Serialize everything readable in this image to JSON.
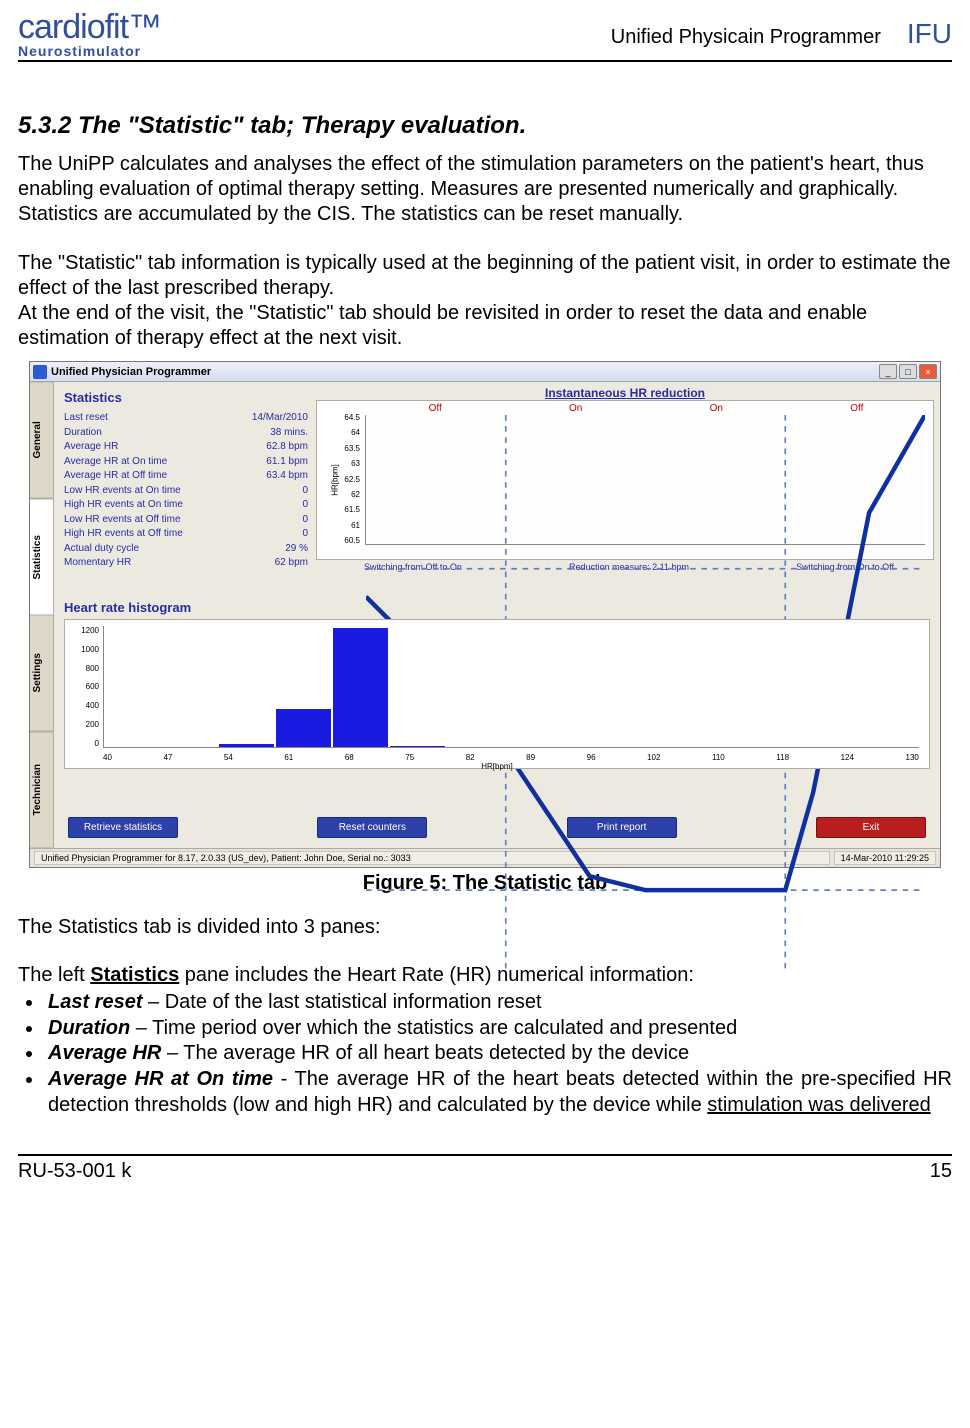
{
  "header": {
    "logo_main": "cardiofit",
    "logo_tm": "™",
    "logo_sub": "Neurostimulator",
    "doc_title": "Unified Physicain Programmer",
    "ifu": "IFU"
  },
  "section": {
    "heading": "5.3.2 The \"Statistic\" tab; Therapy evaluation.",
    "para1": "The UniPP calculates and analyses the effect of the stimulation parameters on the patient's heart, thus enabling evaluation of optimal therapy setting. Measures are presented numerically and graphically. Statistics are accumulated by the CIS. The statistics can be reset manually.",
    "para2": "The \"Statistic\" tab information is typically used at the beginning of the patient visit, in order to estimate the effect of the last prescribed therapy.\nAt the end of the visit, the \"Statistic\" tab should be revisited in order to reset the data and enable estimation of therapy effect at the next visit."
  },
  "screenshot": {
    "window_title": "Unified Physician Programmer",
    "vtabs": [
      "General",
      "Statistics",
      "Settings",
      "Technician"
    ],
    "active_tab_index": 1,
    "stats_title": "Statistics",
    "stats": [
      {
        "label": "Last reset",
        "value": "14/Mar/2010"
      },
      {
        "label": "Duration",
        "value": "38 mins."
      },
      {
        "label": "Average HR",
        "value": "62.8 bpm"
      },
      {
        "label": "Average HR at On time",
        "value": "61.1 bpm"
      },
      {
        "label": "Average HR at Off time",
        "value": "63.4 bpm"
      },
      {
        "label": "Low HR events at On time",
        "value": "0"
      },
      {
        "label": "High HR events at On time",
        "value": "0"
      },
      {
        "label": "Low HR events at Off time",
        "value": "0"
      },
      {
        "label": "High HR events at Off time",
        "value": "0"
      },
      {
        "label": "Actual duty cycle",
        "value": "29 %"
      },
      {
        "label": "Momentary HR",
        "value": "62 bpm"
      }
    ],
    "line_chart_title": "Instantaneous HR reduction",
    "phase_labels": [
      "Off",
      "On",
      "On",
      "Off"
    ],
    "line_footer": {
      "left": "Switching from Off to On",
      "mid": "Reduction measure: 2.11 bpm",
      "right": "Switching from On to Off"
    },
    "ylabel": "HR[bpm]",
    "hist_title": "Heart rate histogram",
    "hist_xlabel": "HR[bpm]",
    "buttons": {
      "retrieve": "Retrieve statistics",
      "reset": "Reset counters",
      "print": "Print report",
      "exit": "Exit"
    },
    "status_left": "Unified Physician Programmer for 8.17,  2.0.33  (US_dev),  Patient: John Doe, Serial no.: 3033",
    "status_right": "14-Mar-2010 11:29:25"
  },
  "chart_data": [
    {
      "type": "line",
      "title": "Instantaneous HR reduction",
      "ylabel": "HR[bpm]",
      "yticks": [
        60.5,
        61,
        61.5,
        62,
        62.5,
        63,
        63.5,
        64,
        64.5
      ],
      "ylim": [
        60.5,
        64.5
      ],
      "phases": [
        "Off",
        "On",
        "On",
        "Off"
      ],
      "phase_boundaries_pct": [
        25,
        75
      ],
      "hlines": [
        61.1,
        63.4
      ],
      "x": [
        0,
        5,
        25,
        40,
        50,
        75,
        80,
        90,
        100
      ],
      "y": [
        63.2,
        63.0,
        62.1,
        61.2,
        61.1,
        61.1,
        61.8,
        63.8,
        64.5
      ],
      "reduction_measure": "2.11 bpm"
    },
    {
      "type": "bar",
      "title": "Heart rate histogram",
      "xlabel": "HR[bpm]",
      "categories": [
        40,
        47,
        54,
        61,
        68,
        75,
        82,
        89,
        96,
        102,
        110,
        118,
        124,
        130
      ],
      "values": [
        0,
        0,
        30,
        380,
        1180,
        10,
        0,
        0,
        0,
        0,
        0,
        0,
        0,
        0
      ],
      "ylim": [
        0,
        1200
      ],
      "yticks": [
        0,
        200,
        400,
        600,
        800,
        1000,
        1200
      ]
    }
  ],
  "fig_caption": "Figure 5: The Statistic tab",
  "post": {
    "lead1": "The Statistics tab is divided into 3 panes:",
    "lead2_pre": "The left ",
    "lead2_u": "Statistics",
    "lead2_post": " pane includes the Heart Rate (HR) numerical information:",
    "bullets": [
      {
        "term": "Last reset",
        "text": " – Date of the last statistical information reset"
      },
      {
        "term": "Duration",
        "text": " – Time period over which the statistics are calculated and presented"
      },
      {
        "term": "Average HR",
        "text": " – The average HR of all heart beats detected by the device"
      },
      {
        "term": "Average HR at On time",
        "text": " - The average HR of the heart beats detected within the pre-specified HR detection thresholds (low and high HR) and calculated by the device while ",
        "u": "stimulation was delivered"
      }
    ]
  },
  "footer": {
    "left": "RU-53-001 k",
    "right": "15"
  }
}
